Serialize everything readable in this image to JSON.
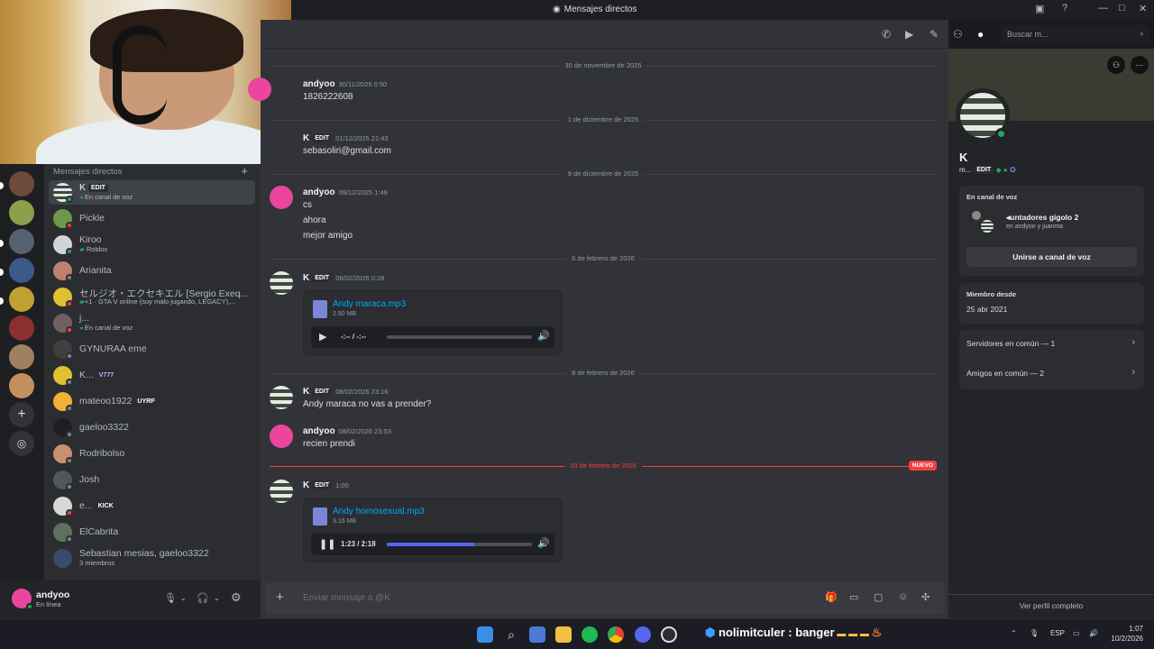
{
  "window": {
    "title": "Mensajes directos",
    "search_placeholder": "Buscar m..."
  },
  "sidebar": {
    "header": "Mensajes directos",
    "items": [
      {
        "name": "K",
        "badge": "EDIT",
        "sub": "En canal de voz"
      },
      {
        "name": "Pickle"
      },
      {
        "name": "Kiroo",
        "sub": "Roblox"
      },
      {
        "name": "Arianita"
      },
      {
        "name": "セルジオ・エクセキエル [Sergio Exeq...",
        "sub": "+1 · GTA V online (soy malo jugando, LEGACY),..."
      },
      {
        "name": "j...",
        "sub": "En canal de voz"
      },
      {
        "name": "GYNURAA eme"
      },
      {
        "name": "K...",
        "badge": "V777"
      },
      {
        "name": "mateoo1922",
        "badge": "UYRP"
      },
      {
        "name": "gaeloo3322"
      },
      {
        "name": "Rodribolso"
      },
      {
        "name": "Josh"
      },
      {
        "name": "e...",
        "badge": "KICK"
      },
      {
        "name": "ElCabrita"
      },
      {
        "name": "Sebastian mesias, gaeloo3322",
        "sub": "3 miembros"
      }
    ]
  },
  "user": {
    "name": "andyoo",
    "status": "En línea"
  },
  "chat": {
    "composer_placeholder": "Enviar mensaje a @K",
    "new_label": "NUEVO",
    "dates": [
      "30 de noviembre de 2025",
      "1 de diciembre de 2025",
      "9 de diciembre de 2025",
      "6 de febrero de 2026",
      "8 de febrero de 2026",
      "10 de febrero de 2026"
    ],
    "messages": [
      {
        "author": "andyoo",
        "time": "30/11/2025 0:50",
        "lines": [
          "1826222608"
        ]
      },
      {
        "author": "K",
        "badge": "EDIT",
        "time": "01/12/2025 21:43",
        "lines": [
          "sebasoliri@gmail.com"
        ]
      },
      {
        "author": "andyoo",
        "time": "09/12/2025 1:49",
        "lines": [
          "cs",
          "ahora",
          "mejor amigo"
        ]
      },
      {
        "author": "K",
        "badge": "EDIT",
        "time": "06/02/2026 0:28",
        "attachment": {
          "name": "Andy maraca.mp3",
          "size": "2.80 MB",
          "time": "-:-- / -:--",
          "progress": 0
        }
      },
      {
        "author": "K",
        "badge": "EDIT",
        "time": "08/02/2026 23:16",
        "lines": [
          "Andy maraca no vas a prender?"
        ]
      },
      {
        "author": "andyoo",
        "time": "08/02/2026 23:53",
        "lines": [
          "recien prendi"
        ]
      },
      {
        "author": "K",
        "badge": "EDIT",
        "time": "1:00",
        "attachment": {
          "name": "Andy homosexual.mp3",
          "size": "3.16 MB",
          "time": "1:23 / 2:18",
          "progress": 0.6
        }
      }
    ]
  },
  "profile": {
    "name": "K",
    "tag": "m...",
    "badge": "EDIT",
    "voice_title": "En canal de voz",
    "voice_channel": "untadores gigolo 2",
    "voice_members": "en andyoo y juanma",
    "join_label": "Unirse a canal de voz",
    "member_since_title": "Miembro desde",
    "member_since": "25 abr 2021",
    "mutual_servers": "Servidores en común — 1",
    "mutual_friends": "Amigos en común — 2",
    "view_full": "Ver perfil completo"
  },
  "taskbar": {
    "overlay": "nolimitculer : banger",
    "lang": "ESP",
    "time": "1:07",
    "date": "10/2/2026"
  },
  "colors": {
    "accent": "#5865f2",
    "online": "#23a55a",
    "new": "#f23f43",
    "link": "#00a8fc"
  }
}
